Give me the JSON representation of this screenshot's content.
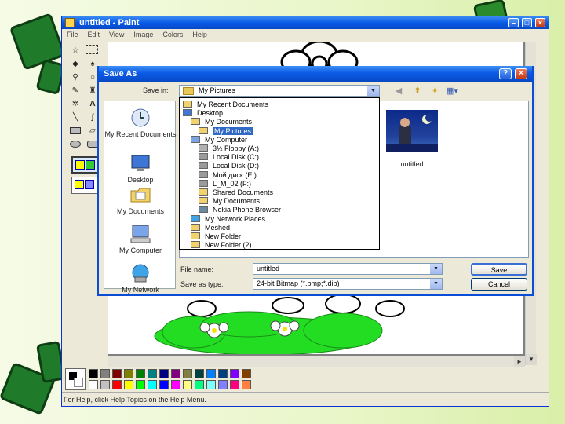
{
  "paint": {
    "title": "untitled - Paint",
    "menu": [
      "File",
      "Edit",
      "View",
      "Image",
      "Colors",
      "Help"
    ],
    "status": "For Help, click Help Topics on the Help Menu."
  },
  "dialog": {
    "title": "Save As",
    "save_in_label": "Save in:",
    "save_in_value": "My Pictures",
    "places": [
      "My Recent Documents",
      "Desktop",
      "My Documents",
      "My Computer",
      "My Network"
    ],
    "dropdown_items": [
      {
        "label": "My Recent Documents",
        "indent": 0,
        "icon": "recent-folder-icon"
      },
      {
        "label": "Desktop",
        "indent": 0,
        "icon": "desktop-icon"
      },
      {
        "label": "My Documents",
        "indent": 1,
        "icon": "folder-icon"
      },
      {
        "label": "My Pictures",
        "indent": 2,
        "icon": "folder-icon",
        "selected": true
      },
      {
        "label": "My Computer",
        "indent": 1,
        "icon": "computer-icon"
      },
      {
        "label": "3½ Floppy (A:)",
        "indent": 2,
        "icon": "floppy-icon"
      },
      {
        "label": "Local Disk (C:)",
        "indent": 2,
        "icon": "disk-icon"
      },
      {
        "label": "Local Disk (D:)",
        "indent": 2,
        "icon": "disk-icon"
      },
      {
        "label": "Мой диск (E:)",
        "indent": 2,
        "icon": "disk-icon"
      },
      {
        "label": "L_M_02 (F:)",
        "indent": 2,
        "icon": "disk-icon"
      },
      {
        "label": "Shared Documents",
        "indent": 2,
        "icon": "folder-icon"
      },
      {
        "label": "My Documents",
        "indent": 2,
        "icon": "folder-icon"
      },
      {
        "label": "Nokia Phone Browser",
        "indent": 2,
        "icon": "phone-icon"
      },
      {
        "label": "My Network Places",
        "indent": 1,
        "icon": "network-icon"
      },
      {
        "label": "Meshed",
        "indent": 1,
        "icon": "folder-icon"
      },
      {
        "label": "New Folder",
        "indent": 1,
        "icon": "folder-icon"
      },
      {
        "label": "New Folder (2)",
        "indent": 1,
        "icon": "folder-icon"
      }
    ],
    "file_thumb_label": "untitled",
    "file_name_label": "File name:",
    "file_name_value": "untitled",
    "save_type_label": "Save as type:",
    "save_type_value": "24-bit Bitmap (*.bmp;*.dib)",
    "save_button": "Save",
    "cancel_button": "Cancel"
  },
  "palette_colors": [
    "#000000",
    "#808080",
    "#800000",
    "#808000",
    "#008000",
    "#008080",
    "#000080",
    "#800080",
    "#808040",
    "#004040",
    "#0080ff",
    "#004080",
    "#8000ff",
    "#804000",
    "#ffffff",
    "#c0c0c0",
    "#ff0000",
    "#ffff00",
    "#00ff00",
    "#00ffff",
    "#0000ff",
    "#ff00ff",
    "#ffff80",
    "#00ff80",
    "#80ffff",
    "#8080ff",
    "#ff0080",
    "#ff8040"
  ]
}
